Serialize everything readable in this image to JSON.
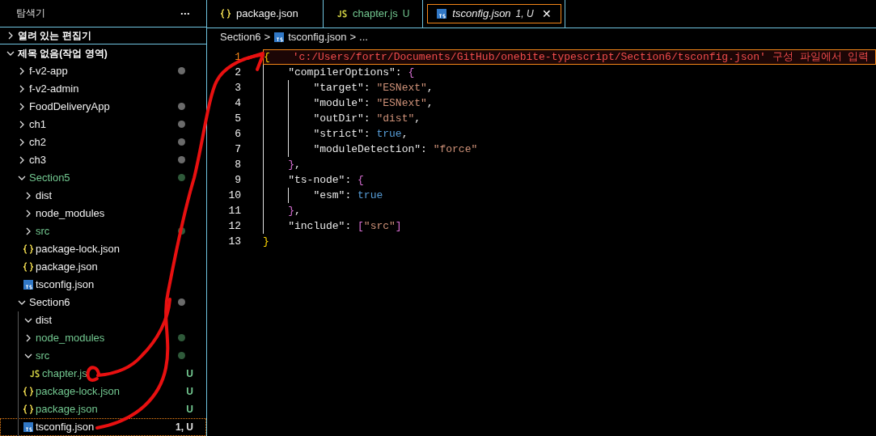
{
  "sidebar": {
    "title": "탐색기",
    "more": "···",
    "sections": [
      {
        "label": "열려 있는 편집기",
        "expanded": false
      },
      {
        "label": "제목 없음(작업 영역)",
        "expanded": true
      }
    ],
    "tree": [
      {
        "label": "f-v2-app",
        "kind": "folder",
        "expanded": false,
        "untracked": false,
        "color": "#6b6b6b",
        "selected": false
      },
      {
        "label": "f-v2-admin",
        "kind": "folder",
        "expanded": false,
        "untracked": false,
        "selected": false
      },
      {
        "label": "FoodDeliveryApp",
        "kind": "folder",
        "expanded": false,
        "untracked": false,
        "color": "#6b6b6b",
        "selected": false
      },
      {
        "label": "ch1",
        "kind": "folder",
        "expanded": false,
        "untracked": false,
        "color": "#6b6b6b",
        "selected": false
      },
      {
        "label": "ch2",
        "kind": "folder",
        "expanded": false,
        "untracked": false,
        "color": "#6b6b6b",
        "selected": false
      },
      {
        "label": "ch3",
        "kind": "folder",
        "expanded": false,
        "untracked": false,
        "color": "#6b6b6b",
        "selected": false
      },
      {
        "label": "Section5",
        "kind": "folder",
        "expanded": true,
        "untracked": true,
        "color": "#2f5a3a",
        "selected": false,
        "children": [
          {
            "label": "dist",
            "kind": "folder",
            "expanded": false,
            "untracked": false,
            "selected": false
          },
          {
            "label": "node_modules",
            "kind": "folder",
            "expanded": false,
            "untracked": false,
            "selected": false
          },
          {
            "label": "src",
            "kind": "folder",
            "expanded": false,
            "untracked": true,
            "color": "#2f5a3a",
            "selected": false
          },
          {
            "label": "package-lock.json",
            "kind": "json",
            "untracked": false,
            "selected": false
          },
          {
            "label": "package.json",
            "kind": "json",
            "untracked": false,
            "selected": false
          },
          {
            "label": "tsconfig.json",
            "kind": "ts",
            "untracked": false,
            "selected": false
          }
        ]
      },
      {
        "label": "Section6",
        "kind": "folder",
        "expanded": true,
        "untracked": false,
        "color": "#6b6b6b",
        "selected": false,
        "children": [
          {
            "label": "dist",
            "kind": "folder",
            "expanded": true,
            "untracked": false,
            "selected": false
          },
          {
            "label": "node_modules",
            "kind": "folder",
            "expanded": false,
            "untracked": true,
            "color": "#2f5a3a",
            "selected": false
          },
          {
            "label": "src",
            "kind": "folder",
            "expanded": true,
            "untracked": true,
            "color": "#2f5a3a",
            "selected": false,
            "children": [
              {
                "label": "chapter.js",
                "kind": "js",
                "untracked": true,
                "badge": "U",
                "selected": false
              }
            ]
          },
          {
            "label": "package-lock.json",
            "kind": "json",
            "untracked": true,
            "badge": "U",
            "selected": false
          },
          {
            "label": "package.json",
            "kind": "json",
            "untracked": true,
            "badge": "U",
            "selected": false
          },
          {
            "label": "tsconfig.json",
            "kind": "ts",
            "untracked": false,
            "badge": "1, U",
            "selected": true
          }
        ]
      }
    ]
  },
  "tabs": [
    {
      "label": "package.json",
      "kind": "json",
      "untracked": false,
      "selected": false
    },
    {
      "label": "chapter.js",
      "kind": "js",
      "untracked": true,
      "badge": "U",
      "selected": false
    },
    {
      "label": "tsconfig.json",
      "kind": "ts",
      "untracked": false,
      "badge": "1, U",
      "close": "✕",
      "selected": true
    }
  ],
  "breadcrumb": [
    {
      "label": "Section6",
      "kind": "folder"
    },
    {
      "label": "tsconfig.json",
      "kind": "ts"
    },
    {
      "label": "...",
      "kind": "more"
    }
  ],
  "separator": ">",
  "lines": [
    {
      "number": "1",
      "current": true,
      "tokens": [
        {
          "kind": "b1",
          "text": "{"
        }
      ],
      "error": "'c:/Users/fortr/Documents/GitHub/onebite-typescript/Section6/tsconfig.json' 구성 파일에서 입력"
    },
    {
      "number": "2",
      "current": false,
      "tokens": [
        {
          "kind": "key",
          "text": "    \"compilerOptions\""
        },
        {
          "kind": "p",
          "text": ": "
        },
        {
          "kind": "b2",
          "text": "{"
        }
      ]
    },
    {
      "number": "3",
      "current": false,
      "tokens": [
        {
          "kind": "key",
          "text": "        \"target\""
        },
        {
          "kind": "p",
          "text": ": "
        },
        {
          "kind": "str",
          "text": "\"ESNext\""
        },
        {
          "kind": "p",
          "text": ","
        }
      ]
    },
    {
      "number": "4",
      "current": false,
      "tokens": [
        {
          "kind": "key",
          "text": "        \"module\""
        },
        {
          "kind": "p",
          "text": ": "
        },
        {
          "kind": "str",
          "text": "\"ESNext\""
        },
        {
          "kind": "p",
          "text": ","
        }
      ]
    },
    {
      "number": "5",
      "current": false,
      "tokens": [
        {
          "kind": "key",
          "text": "        \"outDir\""
        },
        {
          "kind": "p",
          "text": ": "
        },
        {
          "kind": "str",
          "text": "\"dist\""
        },
        {
          "kind": "p",
          "text": ","
        }
      ]
    },
    {
      "number": "6",
      "current": false,
      "tokens": [
        {
          "kind": "key",
          "text": "        \"strict\""
        },
        {
          "kind": "p",
          "text": ": "
        },
        {
          "kind": "bool",
          "text": "true"
        },
        {
          "kind": "p",
          "text": ","
        }
      ]
    },
    {
      "number": "7",
      "current": false,
      "tokens": [
        {
          "kind": "key",
          "text": "        \"moduleDetection\""
        },
        {
          "kind": "p",
          "text": ": "
        },
        {
          "kind": "str",
          "text": "\"force\""
        }
      ]
    },
    {
      "number": "8",
      "current": false,
      "tokens": [
        {
          "kind": "b2",
          "text": "    }"
        },
        {
          "kind": "p",
          "text": ","
        }
      ]
    },
    {
      "number": "9",
      "current": false,
      "tokens": [
        {
          "kind": "key",
          "text": "    \"ts-node\""
        },
        {
          "kind": "p",
          "text": ": "
        },
        {
          "kind": "b2",
          "text": "{"
        }
      ]
    },
    {
      "number": "10",
      "current": false,
      "tokens": [
        {
          "kind": "key",
          "text": "        \"esm\""
        },
        {
          "kind": "p",
          "text": ": "
        },
        {
          "kind": "bool",
          "text": "true"
        }
      ]
    },
    {
      "number": "11",
      "current": false,
      "tokens": [
        {
          "kind": "b2",
          "text": "    }"
        },
        {
          "kind": "p",
          "text": ","
        }
      ]
    },
    {
      "number": "12",
      "current": false,
      "tokens": [
        {
          "kind": "key",
          "text": "    \"include\""
        },
        {
          "kind": "p",
          "text": ": "
        },
        {
          "kind": "b2",
          "text": "["
        },
        {
          "kind": "str",
          "text": "\"src\""
        },
        {
          "kind": "b2",
          "text": "]"
        }
      ]
    },
    {
      "number": "13",
      "current": false,
      "tokens": [
        {
          "kind": "b1",
          "text": "}"
        }
      ]
    }
  ]
}
